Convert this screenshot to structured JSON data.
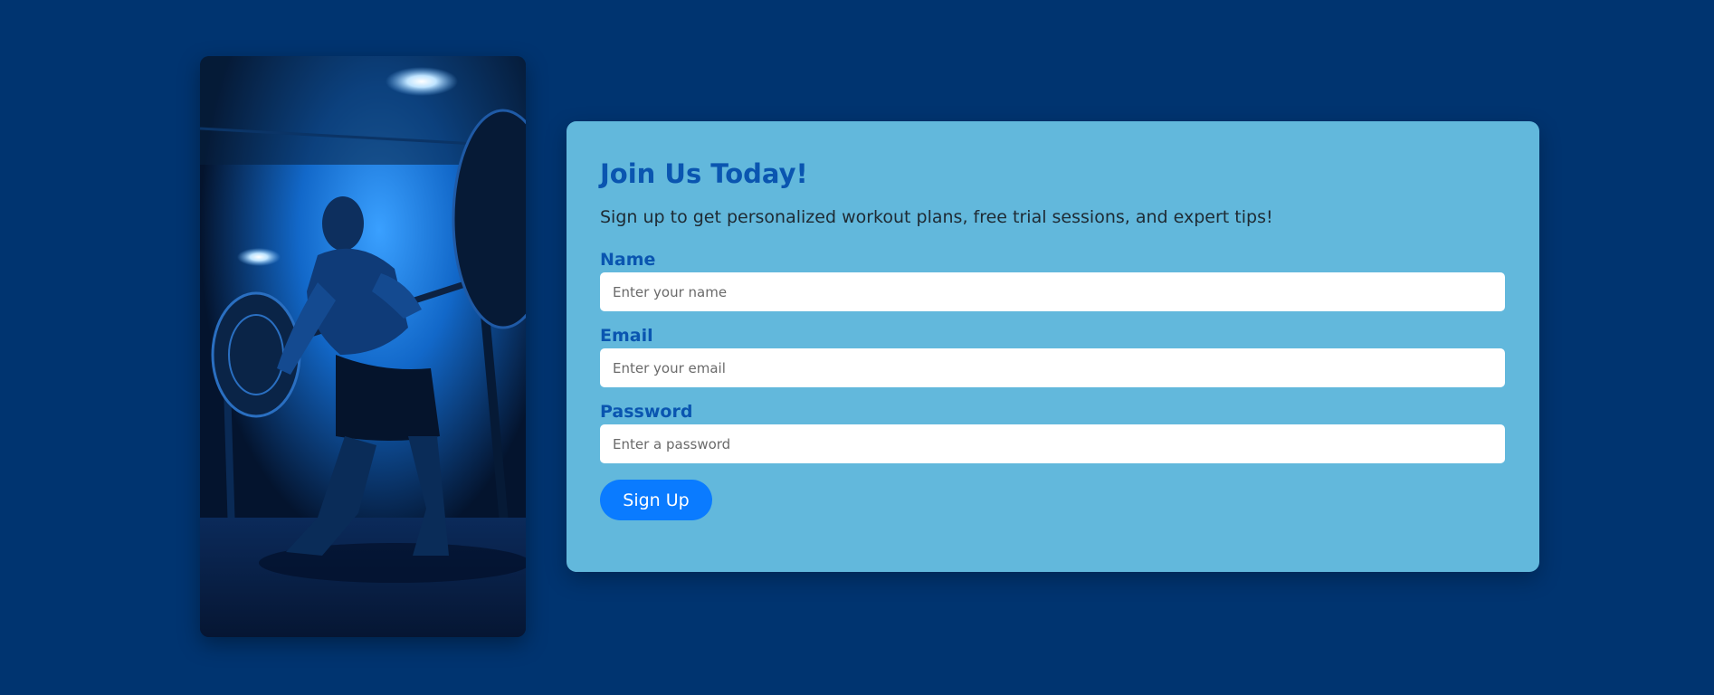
{
  "hero": {
    "image_alt": "athlete-deadlift-photo"
  },
  "form": {
    "title": "Join Us Today!",
    "subtitle": "Sign up to get personalized workout plans, free trial sessions, and expert tips!",
    "fields": [
      {
        "label": "Name",
        "placeholder": "Enter your name",
        "value": ""
      },
      {
        "label": "Email",
        "placeholder": "Enter your email",
        "value": ""
      },
      {
        "label": "Password",
        "placeholder": "Enter a password",
        "value": ""
      }
    ],
    "submit_label": "Sign Up"
  },
  "colors": {
    "page_background": "#003470",
    "card_background": "#62b8dc",
    "accent_text": "#0a55b0",
    "button": "#0a7bff"
  }
}
